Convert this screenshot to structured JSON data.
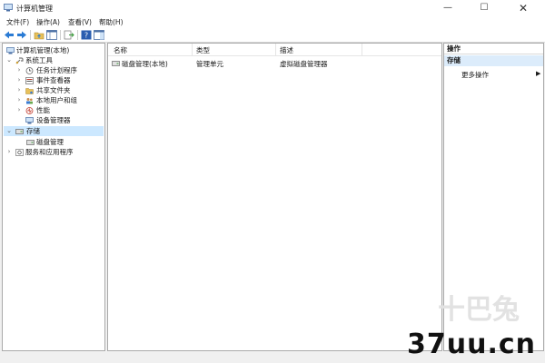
{
  "window": {
    "title": "计算机管理"
  },
  "menu": [
    "文件(F)",
    "操作(A)",
    "查看(V)",
    "帮助(H)"
  ],
  "tree": {
    "root": "计算机管理(本地)",
    "system_tools": "系统工具",
    "task_scheduler": "任务计划程序",
    "event_viewer": "事件查看器",
    "shared_folders": "共享文件夹",
    "local_users": "本地用户和组",
    "performance": "性能",
    "device_manager": "设备管理器",
    "storage": "存储",
    "disk_management": "磁盘管理",
    "services_apps": "服务和应用程序"
  },
  "list": {
    "columns": [
      "名称",
      "类型",
      "描述"
    ],
    "rows": [
      {
        "name": "磁盘管理(本地)",
        "type": "管理单元",
        "description": "虚拟磁盘管理器"
      }
    ]
  },
  "actions": {
    "header": "操作",
    "group": "存储",
    "more": "更多操作"
  },
  "watermark": {
    "text": "37uu.cn",
    "logo": "十巴兔"
  }
}
